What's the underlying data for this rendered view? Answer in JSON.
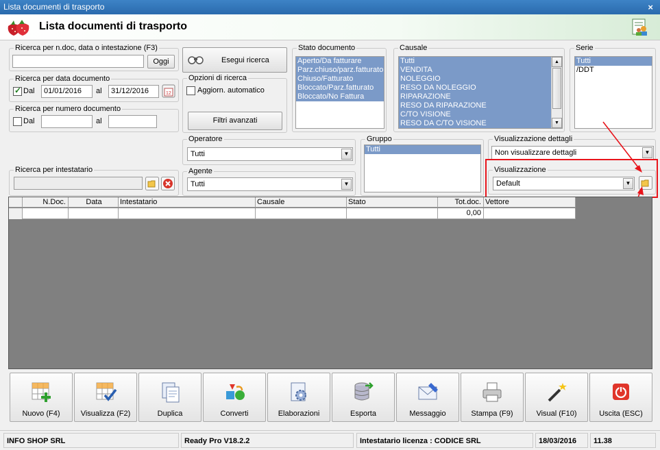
{
  "window": {
    "title": "Lista documenti di trasporto",
    "close_glyph": "×"
  },
  "header": {
    "title": "Lista documenti di trasporto",
    "logo_icon": "strawberry-icon",
    "help_icon": "users-document-icon"
  },
  "search_ndoc": {
    "title": "Ricerca per n.doc, data o intestazione (F3)",
    "value": "",
    "today_button": "Oggi"
  },
  "search_date": {
    "title": "Ricerca per data documento",
    "checked": true,
    "dal_label": "Dal",
    "from": "01/01/2016",
    "al_label": "al",
    "to": "31/12/2016"
  },
  "search_number": {
    "title": "Ricerca per numero documento",
    "checked": false,
    "dal_label": "Dal",
    "from": "",
    "al_label": "al",
    "to": ""
  },
  "search_owner": {
    "title": "Ricerca per intestatario",
    "value": ""
  },
  "run_search": {
    "label": "Esegui ricerca"
  },
  "search_options": {
    "title": "Opzioni di ricerca",
    "auto_update_label": "Aggiorn. automatico",
    "auto_update_checked": false
  },
  "advanced_filters": {
    "label": "Filtri avanzati"
  },
  "doc_state": {
    "title": "Stato documento",
    "items": [
      "Aperto/Da fatturare",
      "Parz.chiuso/parz.fatturato",
      "Chiuso/Fatturato",
      "Bloccato/Parz.fatturato",
      "Bloccato/No Fattura"
    ]
  },
  "causale": {
    "title": "Causale",
    "items": [
      "Tutti",
      "VENDITA",
      "NOLEGGIO",
      "RESO DA NOLEGGIO",
      "RIPARAZIONE",
      "RESO DA RIPARAZIONE",
      "C/TO VISIONE",
      "RESO DA C/TO VISIONE"
    ]
  },
  "serie": {
    "title": "Serie",
    "items": [
      "Tutti",
      "/DDT"
    ]
  },
  "operatore": {
    "title": "Operatore",
    "value": "Tutti"
  },
  "agente": {
    "title": "Agente",
    "value": "Tutti"
  },
  "gruppo": {
    "title": "Gruppo",
    "items": [
      "Tutti"
    ]
  },
  "details_view": {
    "title": "Visualizzazione dettagli",
    "value": "Non visualizzare dettagli"
  },
  "visualizzazione": {
    "title": "Visualizzazione",
    "value": "Default"
  },
  "grid": {
    "columns": [
      "N.Doc.",
      "Data",
      "Intestatario",
      "Causale",
      "Stato",
      "Tot.doc.",
      "Vettore"
    ],
    "rows": [
      [
        "",
        "",
        "",
        "",
        "",
        "0,00",
        ""
      ]
    ]
  },
  "toolbar": [
    {
      "label": "Nuovo (F4)",
      "icon": "new-grid-icon"
    },
    {
      "label": "Visualizza (F2)",
      "icon": "view-grid-icon"
    },
    {
      "label": "Duplica",
      "icon": "duplicate-icon"
    },
    {
      "label": "Converti",
      "icon": "convert-icon"
    },
    {
      "label": "Elaborazioni",
      "icon": "gear-document-icon"
    },
    {
      "label": "Esporta",
      "icon": "database-export-icon"
    },
    {
      "label": "Messaggio",
      "icon": "envelope-icon"
    },
    {
      "label": "Stampa (F9)",
      "icon": "printer-icon"
    },
    {
      "label": "Visual (F10)",
      "icon": "magic-wand-icon"
    },
    {
      "label": "Uscita (ESC)",
      "icon": "power-icon"
    }
  ],
  "status": {
    "company": "INFO SHOP SRL",
    "version": "Ready Pro V18.2.2",
    "license": "Intestatario licenza : CODICE SRL",
    "date": "18/03/2016",
    "time": "11.38"
  },
  "colors": {
    "highlight_box": "#e8141b",
    "list_selection": "#7b9ac8"
  }
}
